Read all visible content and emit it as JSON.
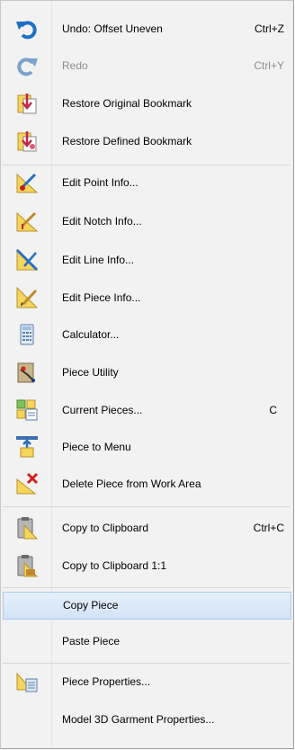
{
  "menu": {
    "items": [
      {
        "label": "Undo: Offset Uneven",
        "shortcut": "Ctrl+Z",
        "icon": "undo-icon"
      },
      {
        "label": "Redo",
        "shortcut": "Ctrl+Y",
        "icon": "redo-icon",
        "disabled": true
      },
      {
        "label": "Restore Original Bookmark",
        "shortcut": "",
        "icon": "bookmark-restore-icon"
      },
      {
        "label": "Restore Defined Bookmark",
        "shortcut": "",
        "icon": "bookmark-defined-icon"
      },
      {
        "label": "Edit Point Info...",
        "shortcut": "",
        "icon": "edit-point-icon"
      },
      {
        "label": "Edit Notch Info...",
        "shortcut": "",
        "icon": "edit-notch-icon"
      },
      {
        "label": "Edit Line Info...",
        "shortcut": "",
        "icon": "edit-line-icon"
      },
      {
        "label": "Edit Piece Info...",
        "shortcut": "",
        "icon": "edit-piece-icon"
      },
      {
        "label": "Calculator...",
        "shortcut": "",
        "icon": "calculator-icon"
      },
      {
        "label": "Piece Utility",
        "shortcut": "",
        "icon": "piece-utility-icon"
      },
      {
        "label": "Current Pieces...",
        "shortcut": "C",
        "icon": "current-pieces-icon"
      },
      {
        "label": "Piece to Menu",
        "shortcut": "",
        "icon": "piece-to-menu-icon"
      },
      {
        "label": "Delete Piece from Work Area",
        "shortcut": "",
        "icon": "delete-piece-icon"
      },
      {
        "label": "Copy to Clipboard",
        "shortcut": "Ctrl+C",
        "icon": "clipboard-icon"
      },
      {
        "label": "Copy to Clipboard 1:1",
        "shortcut": "",
        "icon": "clipboard-scale-icon"
      },
      {
        "label": "Copy Piece",
        "shortcut": "",
        "icon": "",
        "highlighted": true
      },
      {
        "label": "Paste Piece",
        "shortcut": "",
        "icon": ""
      },
      {
        "label": "Piece Properties...",
        "shortcut": "",
        "icon": "piece-properties-icon"
      },
      {
        "label": "Model 3D Garment Properties...",
        "shortcut": "",
        "icon": ""
      }
    ]
  },
  "colors": {
    "highlight": "#d3e3f6",
    "disabled_text": "#8d8d8d",
    "undo_blue": "#1f6fc5",
    "folder_yellow": "#f6d55c",
    "delete_red": "#d42020"
  }
}
